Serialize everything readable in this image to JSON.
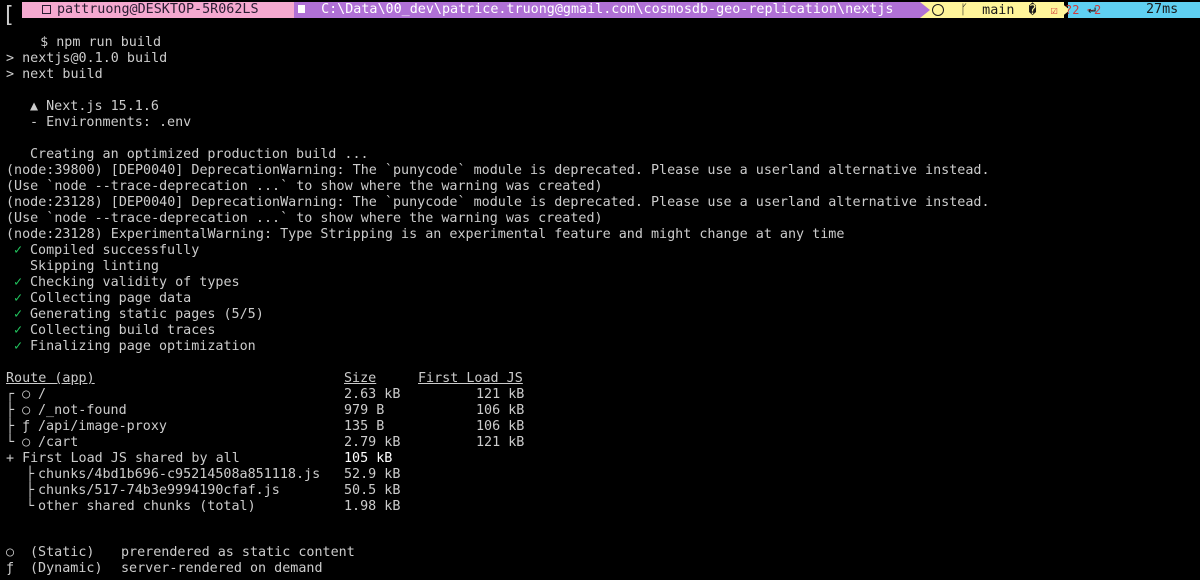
{
  "prompt": {
    "user_host": "pattruong@DESKTOP-5R062LS",
    "path": "C:\\Data\\00_dev\\patrice.truong@gmail.com\\cosmosdb-geo-replication\\nextjs",
    "github_icon": "github-icon",
    "branch_icon": "git-branch-icon",
    "branch": "main",
    "branch_status_glyph": "�",
    "changes": "☑ ?2 ~2",
    "arrow_glyph": "↵",
    "duration": "27ms",
    "command_prefix": "$",
    "command": "npm run build",
    "colors": {
      "user_bg": "#f5a9d0",
      "path_bg": "#b071d6",
      "git_bg": "#fff59a",
      "time_bg": "#5fd0f2",
      "check": "#22c55e"
    }
  },
  "output": {
    "script_lines": [
      "> nextjs@0.1.0 build",
      "> next build"
    ],
    "next_version": "▲ Next.js 15.1.6",
    "environments": "- Environments: .env",
    "creating": "Creating an optimized production build ...",
    "warnings": [
      "(node:39800) [DEP0040] DeprecationWarning: The `punycode` module is deprecated. Please use a userland alternative instead.",
      "(Use `node --trace-deprecation ...` to show where the warning was created)",
      "(node:23128) [DEP0040] DeprecationWarning: The `punycode` module is deprecated. Please use a userland alternative instead.",
      "(Use `node --trace-deprecation ...` to show where the warning was created)",
      "(node:23128) ExperimentalWarning: Type Stripping is an experimental feature and might change at any time"
    ],
    "steps": [
      {
        "check": "✓",
        "text": "Compiled successfully"
      },
      {
        "check": "",
        "text": "Skipping linting"
      },
      {
        "check": "✓",
        "text": "Checking validity of types"
      },
      {
        "check": "✓",
        "text": "Collecting page data"
      },
      {
        "check": "✓",
        "text": "Generating static pages (5/5)"
      },
      {
        "check": "✓",
        "text": "Collecting build traces"
      },
      {
        "check": "✓",
        "text": "Finalizing page optimization"
      }
    ]
  },
  "routes": {
    "headers": {
      "route": "Route (app)",
      "size": "Size",
      "first_load": "First Load JS"
    },
    "rows": [
      {
        "prefix": "┌ ○",
        "route": "/",
        "size": "2.63 kB",
        "first_load": "121 kB"
      },
      {
        "prefix": "├ ○",
        "route": "/_not-found",
        "size": "979 B",
        "first_load": "106 kB"
      },
      {
        "prefix": "├ ƒ",
        "route": "/api/image-proxy",
        "size": "135 B",
        "first_load": "106 kB"
      },
      {
        "prefix": "└ ○",
        "route": "/cart",
        "size": "2.79 kB",
        "first_load": "121 kB"
      }
    ],
    "shared": {
      "label": "+ First Load JS shared by all",
      "size": "105 kB"
    },
    "chunks": [
      {
        "prefix": "├",
        "name": "chunks/4bd1b696-c95214508a851118.js",
        "size": "52.9 kB"
      },
      {
        "prefix": "├",
        "name": "chunks/517-74b3e9994190cfaf.js",
        "size": "50.5 kB"
      },
      {
        "prefix": "└",
        "name": "other shared chunks (total)",
        "size": "1.98 kB"
      }
    ]
  },
  "legend": [
    {
      "symbol": "○",
      "kind": "(Static)",
      "desc": "prerendered as static content"
    },
    {
      "symbol": "ƒ",
      "kind": "(Dynamic)",
      "desc": "server-rendered on demand"
    }
  ]
}
